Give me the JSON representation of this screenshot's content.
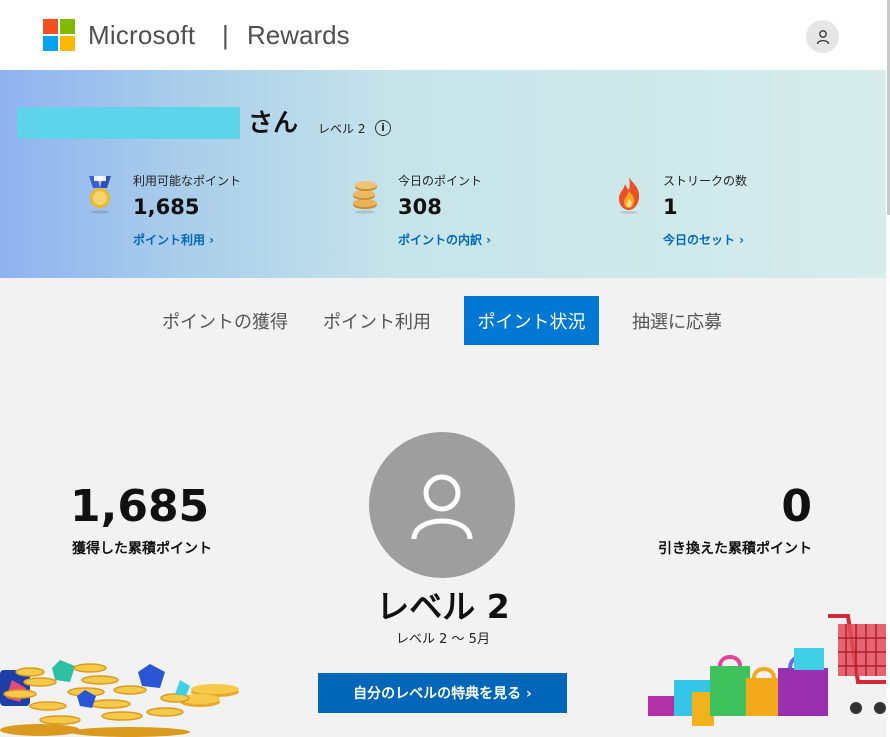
{
  "header": {
    "brand": "Microsoft",
    "divider": "|",
    "product": "Rewards",
    "logo_colors": [
      "#f25022",
      "#7fba00",
      "#00a4ef",
      "#ffb900"
    ],
    "profile_icon": "person-icon"
  },
  "hero": {
    "name_suffix": "さん",
    "level": "レベル 2",
    "info_icon": "info-icon",
    "stats": [
      {
        "label": "利用可能なポイント",
        "value": "1,685",
        "link": "ポイント利用 ›",
        "icon": "medal-icon"
      },
      {
        "label": "今日のポイント",
        "value": "308",
        "link": "ポイントの内訳 ›",
        "icon": "coin-stack-icon"
      },
      {
        "label": "ストリークの数",
        "value": "1",
        "link": "今日のセット ›",
        "icon": "flame-icon"
      }
    ]
  },
  "tabs": [
    {
      "label": "ポイントの獲得",
      "active": false
    },
    {
      "label": "ポイント利用",
      "active": false
    },
    {
      "label": "ポイント状況",
      "active": true
    },
    {
      "label": "抽選に応募",
      "active": false
    }
  ],
  "status": {
    "earned_value": "1,685",
    "earned_label": "獲得した累積ポイント",
    "redeemed_value": "0",
    "redeemed_label": "引き換えた累積ポイント",
    "level_title": "レベル 2",
    "level_period": "レベル 2 ～ 5月",
    "cta_label": "自分のレベルの特典を見る ›"
  },
  "colors": {
    "accent": "#0078d4",
    "link": "#0067b8",
    "name_redaction": "#5dd4ea"
  }
}
